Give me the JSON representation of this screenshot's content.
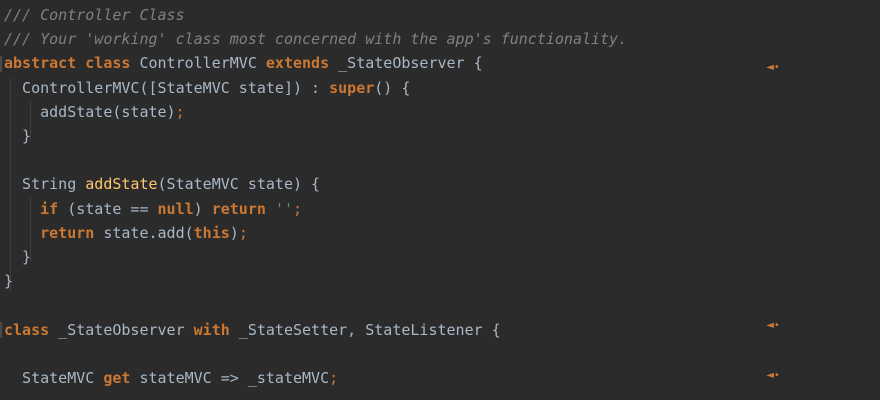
{
  "editor": {
    "lines": [
      [
        {
          "t": "/// Controller Class",
          "c": "comment"
        }
      ],
      [
        {
          "t": "/// Your 'working' class most concerned with the app's functionality.",
          "c": "comment"
        }
      ],
      [
        {
          "t": "abstract",
          "c": "keyword"
        },
        {
          "t": " ",
          "c": "text"
        },
        {
          "t": "class",
          "c": "keyword"
        },
        {
          "t": " ControllerMVC ",
          "c": "text"
        },
        {
          "t": "extends",
          "c": "keyword"
        },
        {
          "t": " _StateObserver {",
          "c": "text"
        }
      ],
      [
        {
          "t": "  ControllerMVC([StateMVC state]) : ",
          "c": "text"
        },
        {
          "t": "super",
          "c": "keyword"
        },
        {
          "t": "() {",
          "c": "text"
        }
      ],
      [
        {
          "t": "    addState(state)",
          "c": "text"
        },
        {
          "t": ";",
          "c": "semi"
        }
      ],
      [
        {
          "t": "  }",
          "c": "text"
        }
      ],
      [],
      [
        {
          "t": "  String ",
          "c": "text"
        },
        {
          "t": "addState",
          "c": "method"
        },
        {
          "t": "(StateMVC state) {",
          "c": "text"
        }
      ],
      [
        {
          "t": "    ",
          "c": "text"
        },
        {
          "t": "if",
          "c": "keyword"
        },
        {
          "t": " (state == ",
          "c": "text"
        },
        {
          "t": "null",
          "c": "keyword"
        },
        {
          "t": ") ",
          "c": "text"
        },
        {
          "t": "return",
          "c": "keyword"
        },
        {
          "t": " ",
          "c": "text"
        },
        {
          "t": "''",
          "c": "string"
        },
        {
          "t": ";",
          "c": "semi"
        }
      ],
      [
        {
          "t": "    ",
          "c": "text"
        },
        {
          "t": "return",
          "c": "keyword"
        },
        {
          "t": " state.add(",
          "c": "text"
        },
        {
          "t": "this",
          "c": "keyword"
        },
        {
          "t": ")",
          "c": "text"
        },
        {
          "t": ";",
          "c": "semi"
        }
      ],
      [
        {
          "t": "  }",
          "c": "text"
        }
      ],
      [
        {
          "t": "}",
          "c": "text"
        }
      ],
      [],
      [
        {
          "t": "class",
          "c": "keyword"
        },
        {
          "t": " _StateObserver ",
          "c": "text"
        },
        {
          "t": "with",
          "c": "keyword"
        },
        {
          "t": " _StateSetter, StateListener {",
          "c": "text"
        }
      ],
      [],
      [
        {
          "t": "  StateMVC ",
          "c": "text"
        },
        {
          "t": "get",
          "c": "keyword"
        },
        {
          "t": " stateMVC => _stateMVC",
          "c": "text"
        },
        {
          "t": ";",
          "c": "semi"
        }
      ]
    ],
    "override_icon": "override-marker-icon",
    "colors": {
      "background": "#2b2b2b",
      "comment": "#808080",
      "keyword": "#cc7832",
      "method": "#ffc66d",
      "text": "#a9b7c6",
      "string": "#6a8759"
    }
  }
}
